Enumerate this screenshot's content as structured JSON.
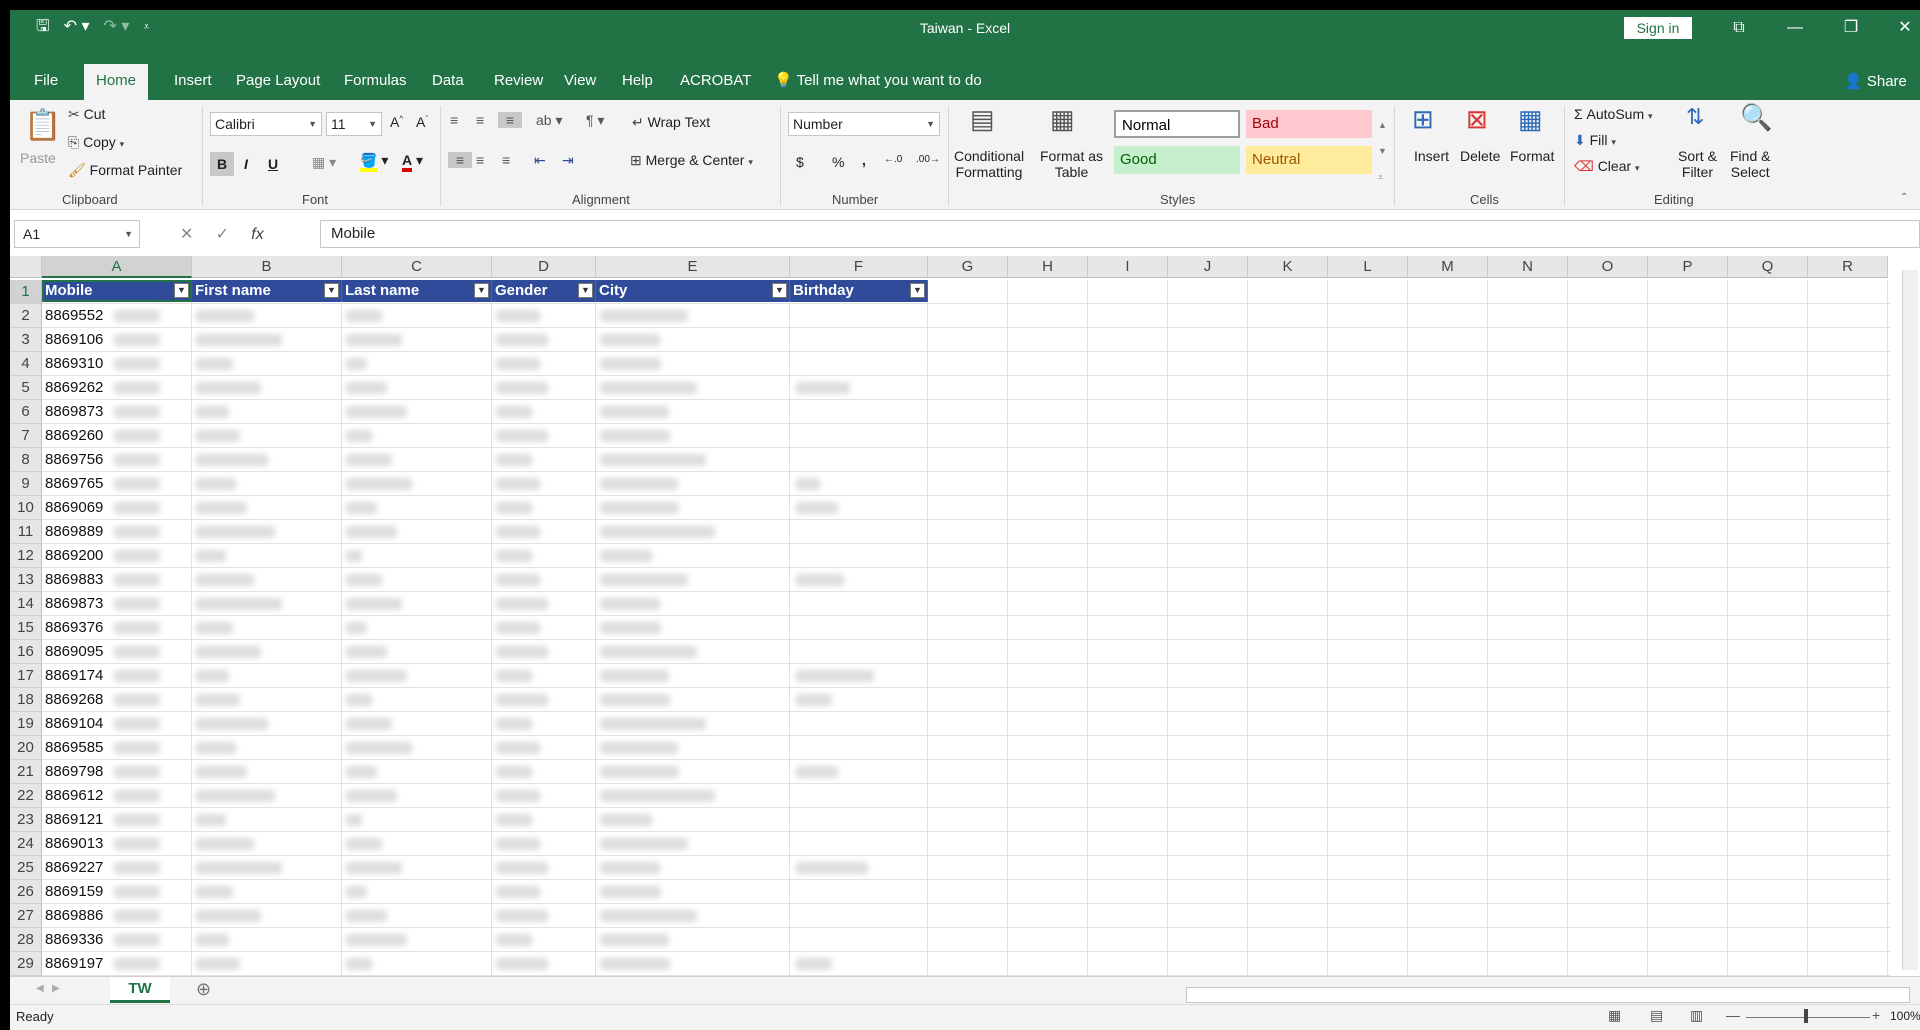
{
  "window": {
    "title": "Taiwan  -  Excel",
    "sign_in": "Sign in",
    "share": "Share"
  },
  "menu_tabs": [
    "File",
    "Home",
    "Insert",
    "Page Layout",
    "Formulas",
    "Data",
    "Review",
    "View",
    "Help",
    "ACROBAT"
  ],
  "tell_me": "Tell me what you want to do",
  "ribbon": {
    "clipboard": {
      "paste": "Paste",
      "cut": "Cut",
      "copy": "Copy",
      "format_painter": "Format Painter",
      "label": "Clipboard"
    },
    "font": {
      "name": "Calibri",
      "size": "11",
      "bold": "B",
      "italic": "I",
      "underline": "U",
      "label": "Font"
    },
    "alignment": {
      "wrap_text": "Wrap Text",
      "merge_center": "Merge & Center",
      "label": "Alignment"
    },
    "number": {
      "format": "Number",
      "currency": "$",
      "percent": "%",
      "comma": ",",
      "label": "Number"
    },
    "styles": {
      "conditional_formatting_1": "Conditional",
      "conditional_formatting_2": "Formatting",
      "format_as_table_1": "Format as",
      "format_as_table_2": "Table",
      "normal": "Normal",
      "bad": "Bad",
      "good": "Good",
      "neutral": "Neutral",
      "label": "Styles"
    },
    "cells": {
      "insert": "Insert",
      "delete": "Delete",
      "format": "Format",
      "label": "Cells"
    },
    "editing": {
      "autosum": "AutoSum",
      "fill": "Fill",
      "clear": "Clear",
      "sort_filter_1": "Sort &",
      "sort_filter_2": "Filter",
      "find_select_1": "Find &",
      "find_select_2": "Select",
      "label": "Editing"
    }
  },
  "formula_bar": {
    "name_box": "A1",
    "fx": "fx",
    "content": "Mobile"
  },
  "columns": [
    "A",
    "B",
    "C",
    "D",
    "E",
    "F",
    "G",
    "H",
    "I",
    "J",
    "K",
    "L",
    "M",
    "N",
    "O",
    "P",
    "Q",
    "R"
  ],
  "table_headers": [
    "Mobile",
    "First name",
    "Last name",
    "Gender",
    "City",
    "Birthday"
  ],
  "rows": [
    {
      "num": "1"
    },
    {
      "num": "2",
      "mobile": "8869552"
    },
    {
      "num": "3",
      "mobile": "8869106"
    },
    {
      "num": "4",
      "mobile": "8869310"
    },
    {
      "num": "5",
      "mobile": "8869262"
    },
    {
      "num": "6",
      "mobile": "8869873"
    },
    {
      "num": "7",
      "mobile": "8869260"
    },
    {
      "num": "8",
      "mobile": "8869756"
    },
    {
      "num": "9",
      "mobile": "8869765"
    },
    {
      "num": "10",
      "mobile": "8869069"
    },
    {
      "num": "11",
      "mobile": "8869889"
    },
    {
      "num": "12",
      "mobile": "8869200"
    },
    {
      "num": "13",
      "mobile": "8869883"
    },
    {
      "num": "14",
      "mobile": "8869873"
    },
    {
      "num": "15",
      "mobile": "8869376"
    },
    {
      "num": "16",
      "mobile": "8869095"
    },
    {
      "num": "17",
      "mobile": "8869174"
    },
    {
      "num": "18",
      "mobile": "8869268"
    },
    {
      "num": "19",
      "mobile": "8869104"
    },
    {
      "num": "20",
      "mobile": "8869585"
    },
    {
      "num": "21",
      "mobile": "8869798"
    },
    {
      "num": "22",
      "mobile": "8869612"
    },
    {
      "num": "23",
      "mobile": "8869121"
    },
    {
      "num": "24",
      "mobile": "8869013"
    },
    {
      "num": "25",
      "mobile": "8869227"
    },
    {
      "num": "26",
      "mobile": "8869159"
    },
    {
      "num": "27",
      "mobile": "8869886"
    },
    {
      "num": "28",
      "mobile": "8869336"
    },
    {
      "num": "29",
      "mobile": "8869197"
    }
  ],
  "sheet_tab": "TW",
  "status": {
    "ready": "Ready",
    "zoom": "100%"
  },
  "colors": {
    "excel_green": "#217346",
    "table_header": "#2f4b9a"
  }
}
